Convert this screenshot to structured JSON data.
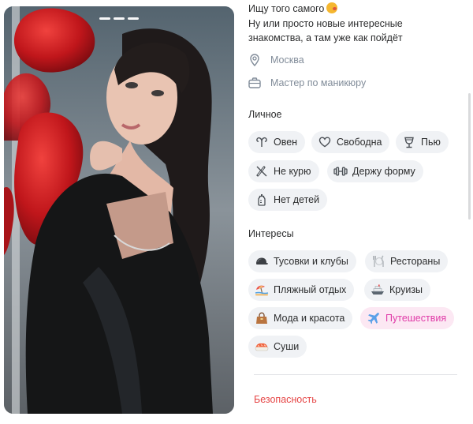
{
  "bio": {
    "line1": "Ищу того самого",
    "line2": "Ну или просто новые интересные",
    "line3": "знакомства, а там уже как пойдёт"
  },
  "info": {
    "city": "Москва",
    "job": "Мастер по маникюру"
  },
  "personal": {
    "title": "Личное",
    "chips": [
      {
        "label": "Овен",
        "icon": "aries-icon"
      },
      {
        "label": "Свободна",
        "icon": "heart-icon"
      },
      {
        "label": "Пью",
        "icon": "wine-glass-icon"
      },
      {
        "label": "Не курю",
        "icon": "no-smoking-icon"
      },
      {
        "label": "Держу форму",
        "icon": "dumbbell-icon"
      },
      {
        "label": "Нет детей",
        "icon": "baby-bottle-icon"
      }
    ]
  },
  "interests": {
    "title": "Интересы",
    "chips": [
      {
        "label": "Тусовки и клубы",
        "icon": "cap-icon"
      },
      {
        "label": "Рестораны",
        "icon": "cutlery-icon"
      },
      {
        "label": "Пляжный отдых",
        "icon": "beach-icon"
      },
      {
        "label": "Круизы",
        "icon": "ship-icon"
      },
      {
        "label": "Мода и красота",
        "icon": "handbag-icon"
      },
      {
        "label": "Путешествия",
        "icon": "airplane-icon",
        "selected": true
      },
      {
        "label": "Суши",
        "icon": "sushi-icon"
      }
    ]
  },
  "footer": {
    "safety_link": "Безопасность"
  },
  "colors": {
    "chip_bg": "#f0f2f5",
    "highlight_bg": "#fce8f3",
    "highlight_text": "#e03ba8",
    "secondary_text": "#818c99",
    "link_red": "#e64646"
  }
}
